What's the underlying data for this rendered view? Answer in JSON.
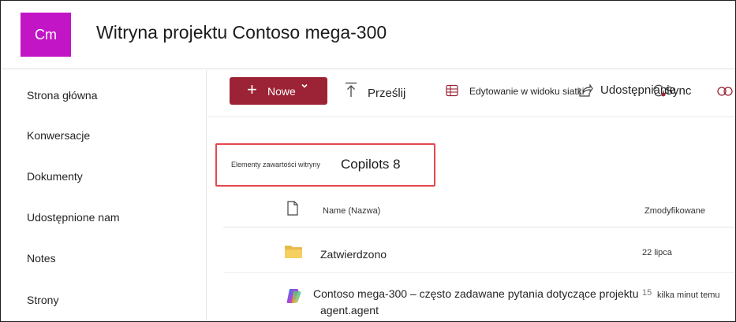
{
  "site": {
    "logo_text": "Cm",
    "logo_color": "#c216c6",
    "title": "Witryna projektu Contoso mega-300"
  },
  "sidebar": {
    "items": [
      {
        "label": "Strona główna"
      },
      {
        "label": "Konwersacje"
      },
      {
        "label": "Dokumenty"
      },
      {
        "label": "Udostępnione nam"
      },
      {
        "label": "Notes"
      },
      {
        "label": "Strony"
      }
    ]
  },
  "toolbar": {
    "new_label": "Nowe",
    "new_button_color": "#9b2335",
    "upload_label": "Prześlij",
    "grid_edit_label": "Edytowanie w widoku siatki",
    "share_label": "Udostępnianie",
    "sync_label": "Sync"
  },
  "breadcrumb": {
    "small": "Elementy zawartości witryny",
    "large": "Copilots 8",
    "highlight_color": "#e5484d"
  },
  "list": {
    "columns": {
      "name": "Name (Nazwa)",
      "modified": "Zmodyfikowane"
    },
    "rows": [
      {
        "icon": "folder-icon",
        "name": "Zatwierdzono",
        "modified": "22 lipca"
      },
      {
        "icon": "copilot-agent-icon",
        "name": "Contoso mega-300 – często zadawane pytania dotyczące projektu",
        "name_line2": "agent.agent",
        "modified_prefix": "15",
        "modified": "kilka minut temu"
      }
    ]
  }
}
